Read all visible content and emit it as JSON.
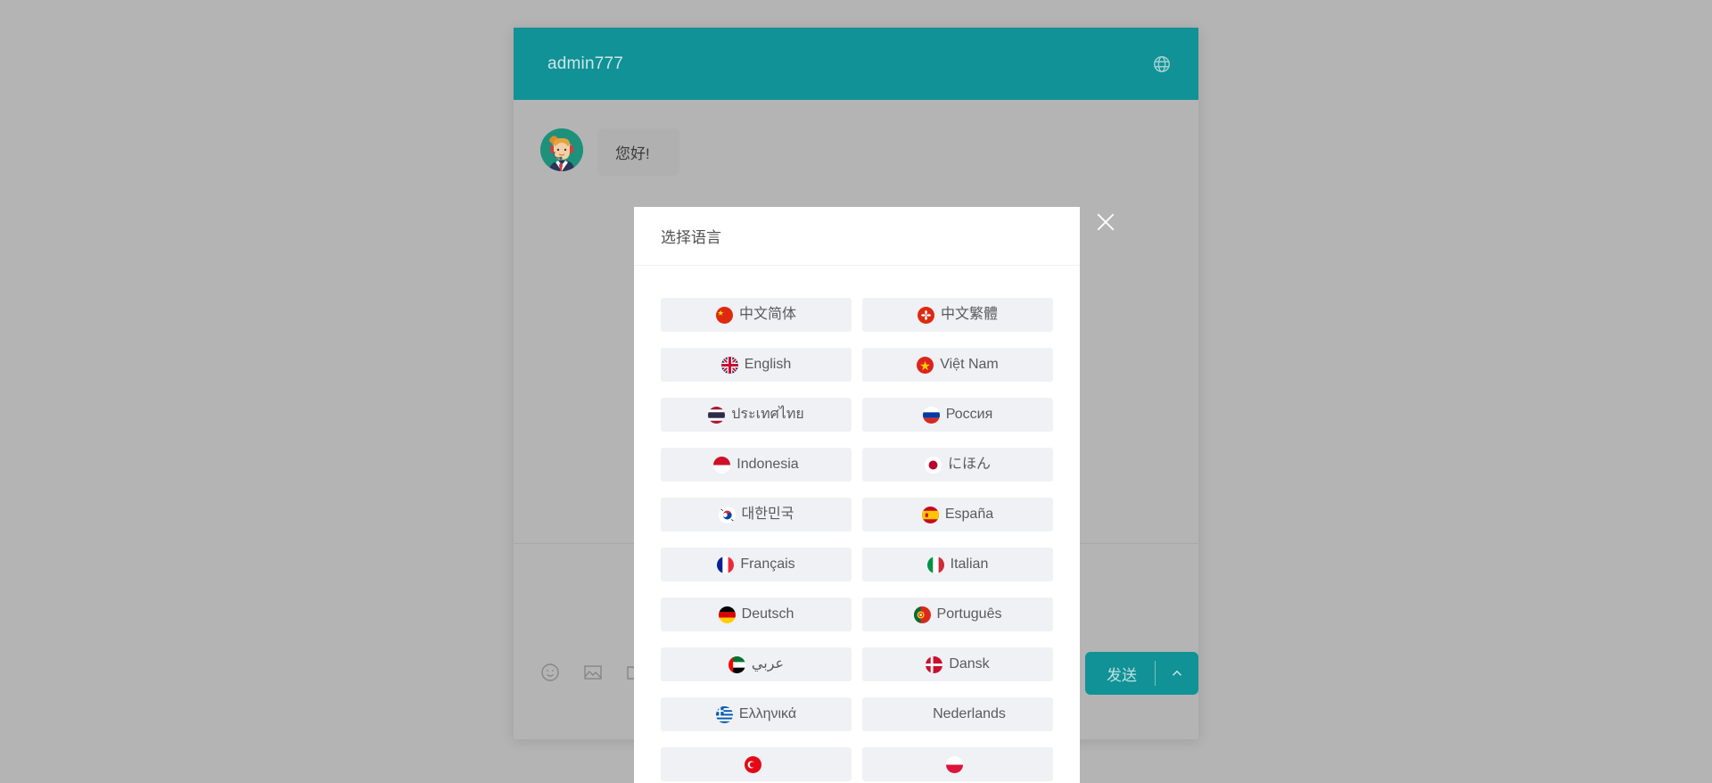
{
  "page": {
    "background_color": "#b4b4b5"
  },
  "chat": {
    "header": {
      "title": "admin777",
      "accent_color": "#109296",
      "language_icon": "globe-icon"
    },
    "messages": [
      {
        "sender": "agent",
        "avatar": "support-agent-avatar",
        "text": "您好!"
      }
    ],
    "toolbar": {
      "items": [
        {
          "name": "emoji-icon",
          "label": "emoji"
        },
        {
          "name": "image-icon",
          "label": "image"
        },
        {
          "name": "folder-icon",
          "label": "file"
        }
      ]
    },
    "send": {
      "label": "发送",
      "caret_icon": "chevron-up-icon"
    }
  },
  "language_modal": {
    "title": "选择语言",
    "close_icon": "close-icon",
    "items": [
      {
        "flag": "cn",
        "label": "中文简体"
      },
      {
        "flag": "hk",
        "label": "中文繁體"
      },
      {
        "flag": "gb",
        "label": "English"
      },
      {
        "flag": "vn",
        "label": "Việt Nam"
      },
      {
        "flag": "th",
        "label": "ประเทศไทย"
      },
      {
        "flag": "ru",
        "label": "Россия"
      },
      {
        "flag": "id",
        "label": "Indonesia"
      },
      {
        "flag": "jp",
        "label": "にほん"
      },
      {
        "flag": "kr",
        "label": "대한민국"
      },
      {
        "flag": "es",
        "label": "España"
      },
      {
        "flag": "fr",
        "label": "Français"
      },
      {
        "flag": "it",
        "label": "Italian"
      },
      {
        "flag": "de",
        "label": "Deutsch"
      },
      {
        "flag": "pt",
        "label": "Português"
      },
      {
        "flag": "ae",
        "label": "عربي"
      },
      {
        "flag": "dk",
        "label": "Dansk"
      },
      {
        "flag": "gr",
        "label": "Ελληνικά"
      },
      {
        "flag": "nl",
        "label": "Nederlands"
      },
      {
        "flag": "tr",
        "label": ""
      },
      {
        "flag": "pl",
        "label": ""
      }
    ]
  }
}
